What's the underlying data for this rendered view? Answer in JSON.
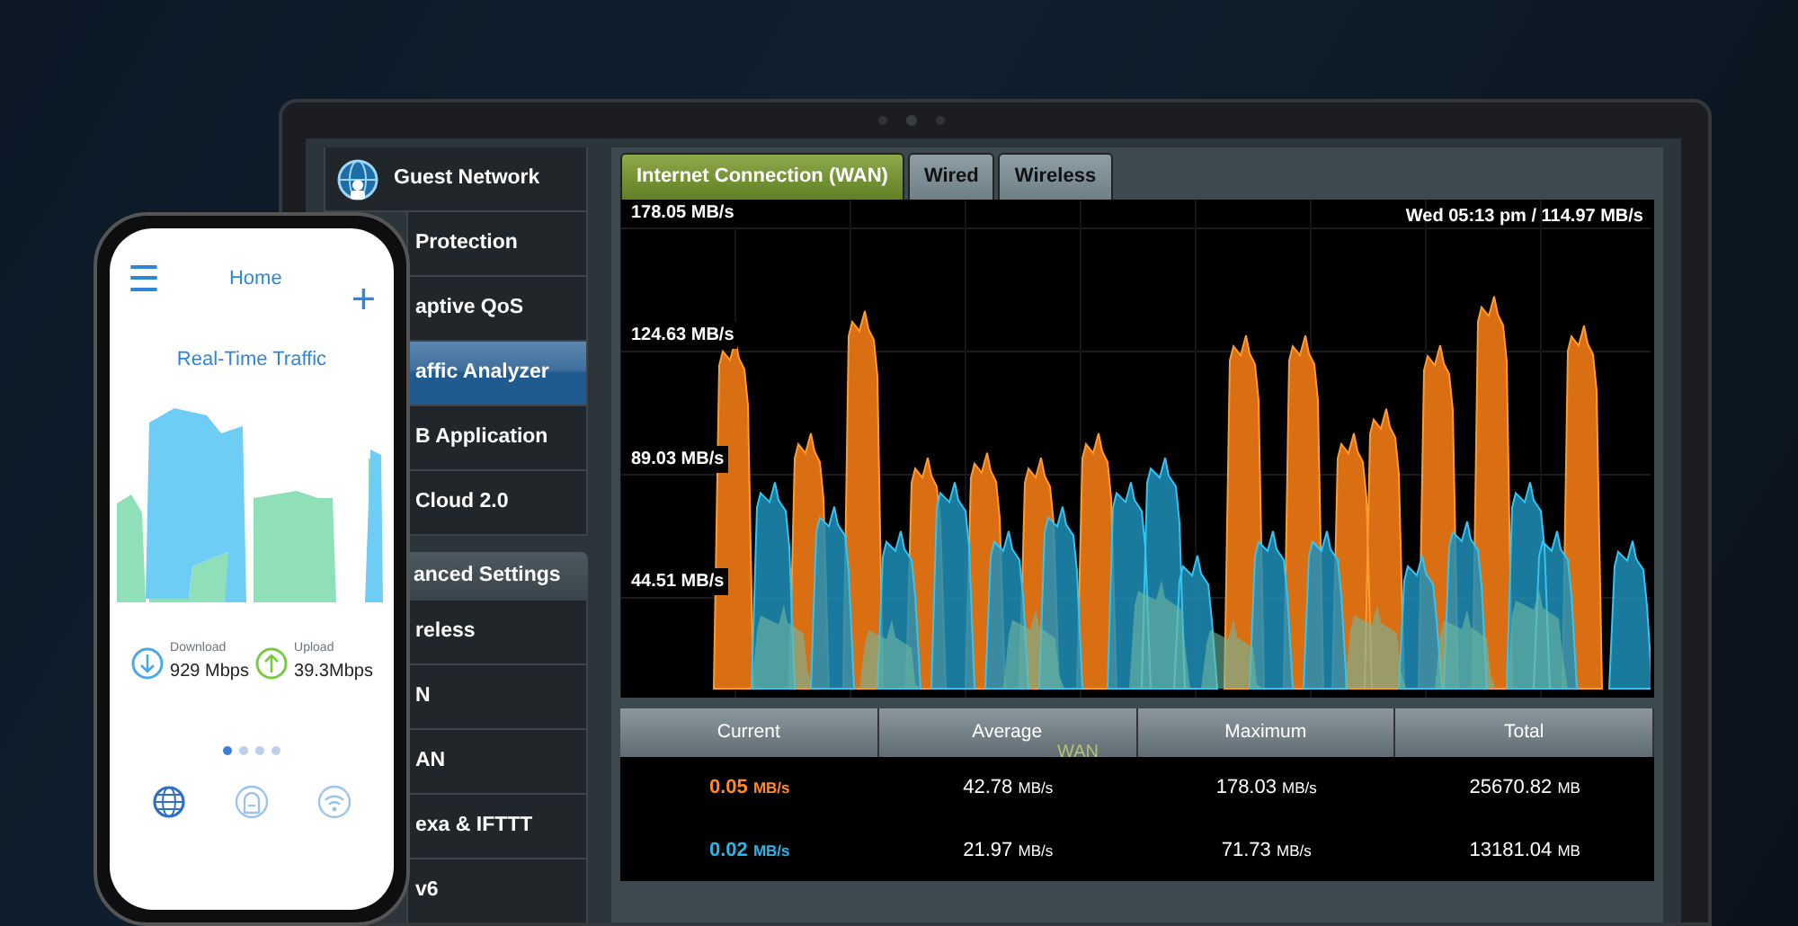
{
  "sidebar": {
    "items": [
      {
        "kind": "icon_item",
        "label": "Guest Network",
        "selected": false
      },
      {
        "kind": "item",
        "label": "Protection",
        "selected": false
      },
      {
        "kind": "item",
        "label": "aptive QoS",
        "selected": false
      },
      {
        "kind": "item",
        "label": "affic Analyzer",
        "selected": true
      },
      {
        "kind": "item",
        "label": "B Application",
        "selected": false
      },
      {
        "kind": "item",
        "label": "Cloud 2.0",
        "selected": false
      },
      {
        "kind": "header",
        "label": "anced Settings"
      },
      {
        "kind": "item",
        "label": "reless",
        "selected": false
      },
      {
        "kind": "item",
        "label": "N",
        "selected": false
      },
      {
        "kind": "item",
        "label": "AN",
        "selected": false
      },
      {
        "kind": "item",
        "label": "exa & IFTTT",
        "selected": false
      },
      {
        "kind": "item",
        "label": "v6",
        "selected": false
      }
    ]
  },
  "tabs": [
    {
      "label": "Internet Connection (WAN)",
      "selected": true
    },
    {
      "label": "Wired",
      "selected": false
    },
    {
      "label": "Wireless",
      "selected": false
    }
  ],
  "graph": {
    "y_labels": [
      "178.05 MB/s",
      "124.63 MB/s",
      "89.03 MB/s",
      "44.51 MB/s"
    ],
    "timestamp": "Wed 05:13 pm / 114.97 MB/s"
  },
  "table": {
    "columns": [
      "Current",
      "Average",
      "Maximum",
      "Total"
    ],
    "overlay_label": "WAN",
    "rows": [
      {
        "color": "#ff8a1e",
        "cells": [
          {
            "value": "0.05",
            "unit": "MB/s"
          },
          {
            "value": "42.78",
            "unit": "MB/s"
          },
          {
            "value": "178.03",
            "unit": "MB/s"
          },
          {
            "value": "25670.82",
            "unit": "MB"
          }
        ]
      },
      {
        "color": "#2ab4ea",
        "cells": [
          {
            "value": "0.02",
            "unit": "MB/s"
          },
          {
            "value": "21.97",
            "unit": "MB/s"
          },
          {
            "value": "71.73",
            "unit": "MB/s"
          },
          {
            "value": "13181.04",
            "unit": "MB"
          }
        ]
      }
    ]
  },
  "phone": {
    "menu_glyph": "☰",
    "title": "Home",
    "add_glyph": "+",
    "chart_title": "Real-Time Traffic",
    "stats": [
      {
        "kind": "download",
        "label": "Download",
        "value": "929 Mbps"
      },
      {
        "kind": "upload",
        "label": "Upload",
        "value": "39.3Mbps"
      }
    ],
    "pages": [
      {
        "selected": true
      },
      {
        "selected": false
      },
      {
        "selected": false
      },
      {
        "selected": false
      }
    ],
    "nav": [
      {
        "kind": "globe",
        "selected": true
      },
      {
        "kind": "router",
        "selected": false
      },
      {
        "kind": "wifi",
        "selected": false
      }
    ]
  }
}
